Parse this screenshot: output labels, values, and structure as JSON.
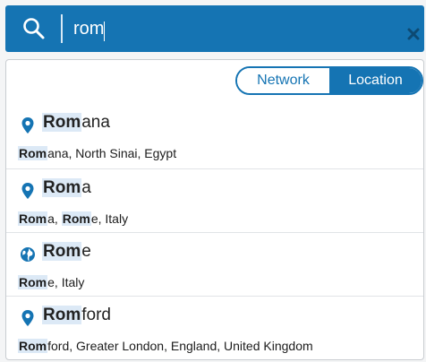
{
  "search": {
    "value": "rom",
    "icon": "search-icon",
    "clear_icon": "close-icon"
  },
  "toggle": {
    "options": [
      {
        "label": "Network",
        "active": false
      },
      {
        "label": "Location",
        "active": true
      }
    ]
  },
  "results": [
    {
      "icon": "location-pin-icon",
      "title_match": "Rom",
      "title_rest": "ana",
      "sub": [
        {
          "match": "Rom",
          "rest": "ana, North Sinai, Egypt"
        }
      ]
    },
    {
      "icon": "location-pin-icon",
      "title_match": "Rom",
      "title_rest": "a",
      "sub": [
        {
          "match": "Rom",
          "rest": "a, "
        },
        {
          "match": "Rom",
          "rest": "e, Italy"
        }
      ]
    },
    {
      "icon": "globe-icon",
      "title_match": "Rom",
      "title_rest": "e",
      "sub": [
        {
          "match": "Rom",
          "rest": "e, Italy"
        }
      ]
    },
    {
      "icon": "location-pin-icon",
      "title_match": "Rom",
      "title_rest": "ford",
      "sub": [
        {
          "match": "Rom",
          "rest": "ford, Greater London, England, United Kingdom"
        }
      ]
    }
  ],
  "colors": {
    "accent": "#1574b3",
    "highlight": "#dce9f6"
  }
}
